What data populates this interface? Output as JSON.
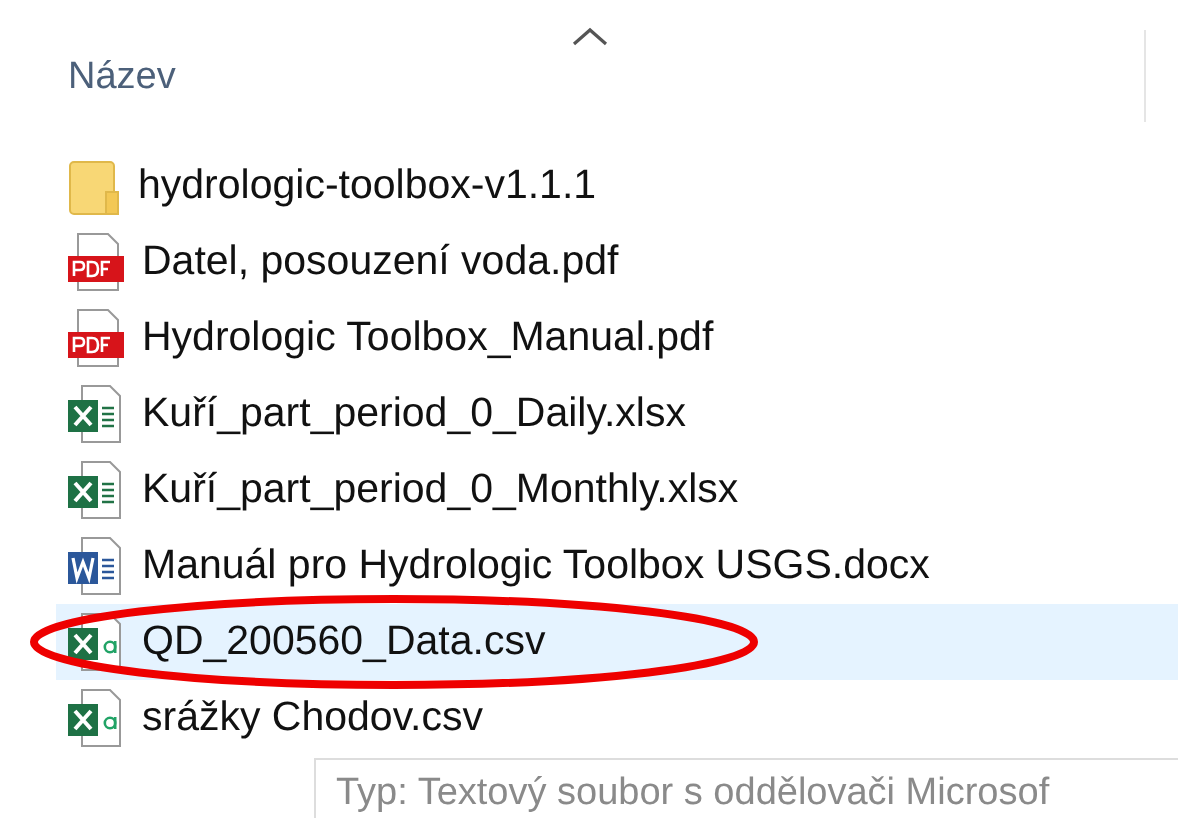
{
  "column_header": {
    "label": "Název"
  },
  "files": [
    {
      "name": "hydrologic-toolbox-v1.1.1",
      "kind": "folder",
      "selected": false,
      "circled": false
    },
    {
      "name": "Datel, posouzení voda.pdf",
      "kind": "pdf",
      "selected": false,
      "circled": false
    },
    {
      "name": "Hydrologic Toolbox_Manual.pdf",
      "kind": "pdf",
      "selected": false,
      "circled": false
    },
    {
      "name": "Kuří_part_period_0_Daily.xlsx",
      "kind": "xlsx",
      "selected": false,
      "circled": false
    },
    {
      "name": "Kuří_part_period_0_Monthly.xlsx",
      "kind": "xlsx",
      "selected": false,
      "circled": false
    },
    {
      "name": "Manuál pro Hydrologic Toolbox USGS.docx",
      "kind": "docx",
      "selected": false,
      "circled": false
    },
    {
      "name": "QD_200560_Data.csv",
      "kind": "csv",
      "selected": true,
      "circled": true
    },
    {
      "name": "srážky Chodov.csv",
      "kind": "csv",
      "selected": false,
      "circled": false
    }
  ],
  "tooltip": {
    "lines": [
      "Typ: Textový soubor s oddělovači Microsof"
    ]
  }
}
